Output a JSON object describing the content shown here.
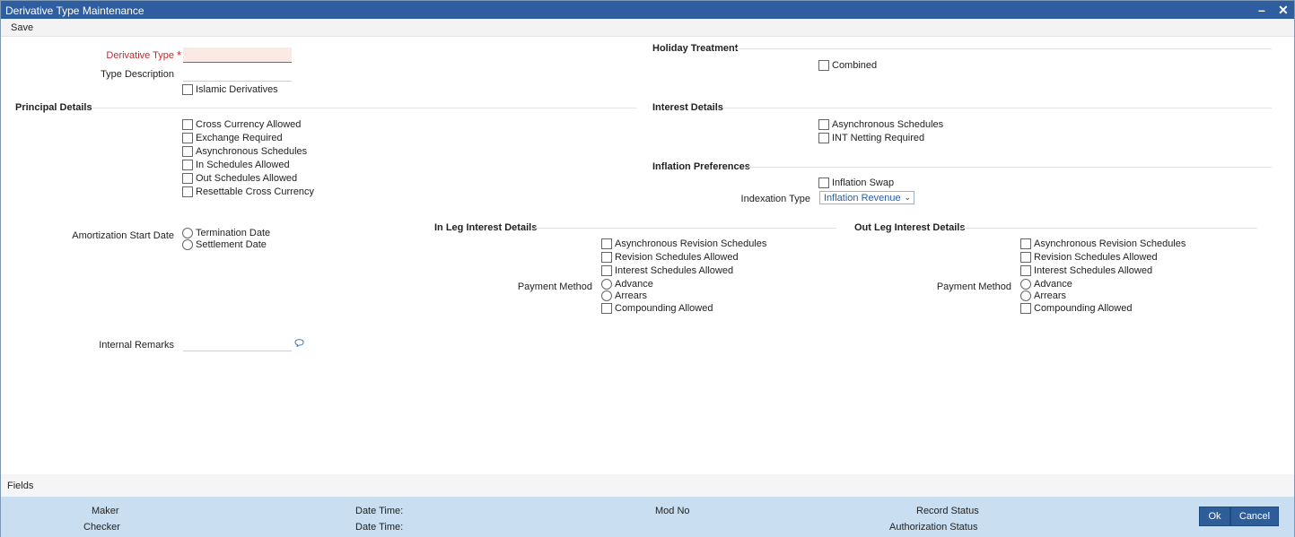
{
  "window": {
    "title": "Derivative Type Maintenance",
    "minimize_glyph": "–",
    "close_glyph": "✕"
  },
  "toolbar": {
    "save_label": "Save"
  },
  "main": {
    "derivative_type": {
      "label": "Derivative Type",
      "required_mark": "*",
      "value": ""
    },
    "type_description": {
      "label": "Type Description",
      "value": ""
    },
    "islamic_derivatives": "Islamic Derivatives",
    "principal": {
      "title": "Principal Details",
      "items": [
        "Cross Currency Allowed",
        "Exchange Required",
        "Asynchronous Schedules",
        "In Schedules Allowed",
        "Out Schedules Allowed",
        "Resettable Cross Currency"
      ]
    },
    "amortization": {
      "label": "Amortization Start Date",
      "options": [
        "Termination Date",
        "Settlement Date"
      ]
    },
    "internal_remarks": {
      "label": "Internal Remarks",
      "value": "",
      "icon": "speech-bubble-icon"
    },
    "holiday": {
      "title": "Holiday Treatment",
      "combined": "Combined"
    },
    "interest": {
      "title": "Interest Details",
      "items": [
        "Asynchronous Schedules",
        "INT Netting Required"
      ]
    },
    "inflation": {
      "title": "Inflation Preferences",
      "swap": "Inflation Swap",
      "indexation_label": "Indexation Type",
      "indexation_value": "Inflation Revenue"
    },
    "in_leg": {
      "title": "In Leg Interest Details",
      "items": [
        "Asynchronous Revision Schedules",
        "Revision Schedules Allowed",
        "Interest Schedules Allowed"
      ],
      "payment_method_label": "Payment Method",
      "payment_options": [
        "Advance",
        "Arrears"
      ],
      "compounding": "Compounding Allowed"
    },
    "out_leg": {
      "title": "Out Leg Interest Details",
      "items": [
        "Asynchronous Revision Schedules",
        "Revision Schedules Allowed",
        "Interest Schedules Allowed"
      ],
      "payment_method_label": "Payment Method",
      "payment_options": [
        "Advance",
        "Arrears"
      ],
      "compounding": "Compounding Allowed"
    }
  },
  "fields_bar": {
    "label": "Fields"
  },
  "footer": {
    "maker": "Maker",
    "checker": "Checker",
    "date_time_1": "Date Time:",
    "date_time_2": "Date Time:",
    "mod_no": "Mod No",
    "record_status": "Record Status",
    "authorization_status": "Authorization Status",
    "ok": "Ok",
    "cancel": "Cancel"
  },
  "colors": {
    "titlebar": "#2e5ea0",
    "footer": "#c9def0",
    "button": "#2d5e9a",
    "required": "#c6282b"
  }
}
